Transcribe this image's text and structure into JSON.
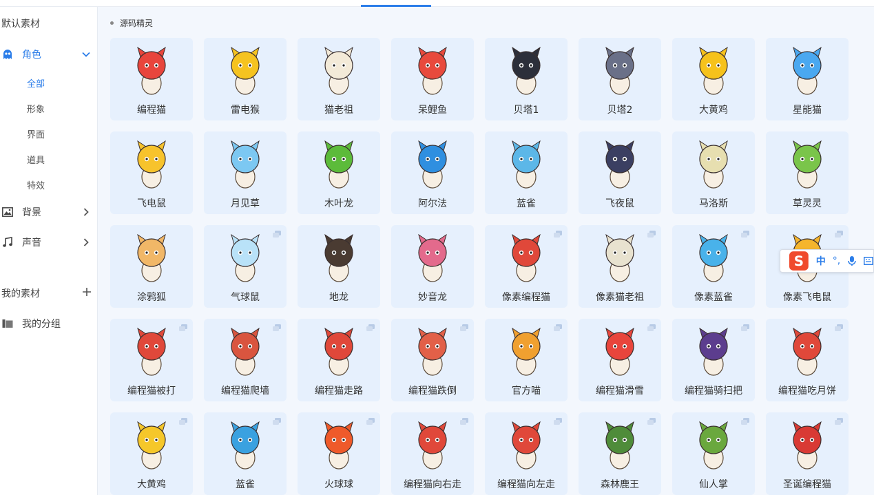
{
  "colors": {
    "accent": "#2b7de9",
    "card_bg": "#e6f0fd",
    "main_bg": "#f3f7fd"
  },
  "sidebar": {
    "default_assets_title": "默认素材",
    "categories": [
      {
        "label": "角色",
        "icon": "ghost-icon",
        "expanded": true
      },
      {
        "label": "背景",
        "icon": "image-icon",
        "expanded": false
      },
      {
        "label": "声音",
        "icon": "music-icon",
        "expanded": false
      }
    ],
    "subcategories": [
      "全部",
      "形象",
      "界面",
      "道具",
      "特效"
    ],
    "my_assets_title": "我的素材",
    "my_groups_label": "我的分组"
  },
  "main": {
    "group_title": "源码精灵",
    "items": [
      {
        "name": "编程猫",
        "icon": "coding-cat-icon",
        "color": "#e8453c",
        "multi": false
      },
      {
        "name": "雷电猴",
        "icon": "thunder-monkey-icon",
        "color": "#f5c320",
        "multi": false
      },
      {
        "name": "猫老祖",
        "icon": "cat-elder-icon",
        "color": "#f3ead8",
        "multi": false
      },
      {
        "name": "呆鲤鱼",
        "icon": "carp-icon",
        "color": "#e84a3d",
        "multi": false
      },
      {
        "name": "贝塔1",
        "icon": "beta-robot-icon",
        "color": "#2c2f3a",
        "multi": false
      },
      {
        "name": "贝塔2",
        "icon": "beta-robot-icon",
        "color": "#6a7088",
        "multi": false
      },
      {
        "name": "大黄鸡",
        "icon": "yellow-chicken-icon",
        "color": "#f6c21c",
        "multi": false
      },
      {
        "name": "星能猫",
        "icon": "star-cat-icon",
        "color": "#4aa8f0",
        "multi": false
      },
      {
        "name": "飞电鼠",
        "icon": "flying-mouse-icon",
        "color": "#f7c32c",
        "multi": false
      },
      {
        "name": "月见草",
        "icon": "moon-grass-icon",
        "color": "#7cc8f2",
        "multi": false
      },
      {
        "name": "木叶龙",
        "icon": "leaf-dragon-icon",
        "color": "#5cbb3a",
        "multi": false
      },
      {
        "name": "阿尔法",
        "icon": "alpha-icon",
        "color": "#2f8fe0",
        "multi": false
      },
      {
        "name": "蓝雀",
        "icon": "blue-bird-icon",
        "color": "#5cb7e8",
        "multi": false
      },
      {
        "name": "飞夜鼠",
        "icon": "night-mouse-icon",
        "color": "#3b3f62",
        "multi": false
      },
      {
        "name": "马洛斯",
        "icon": "maros-icon",
        "color": "#e7dfb0",
        "multi": false
      },
      {
        "name": "草灵灵",
        "icon": "grass-spirit-icon",
        "color": "#7ac54a",
        "multi": false
      },
      {
        "name": "涂鸦狐",
        "icon": "graffiti-fox-icon",
        "color": "#f1b767",
        "multi": false
      },
      {
        "name": "气球鼠",
        "icon": "balloon-mouse-icon",
        "color": "#b9e2f8",
        "multi": true
      },
      {
        "name": "地龙",
        "icon": "earth-dragon-icon",
        "color": "#4a3b32",
        "multi": false
      },
      {
        "name": "妙音龙",
        "icon": "melody-dragon-icon",
        "color": "#e36a8c",
        "multi": false
      },
      {
        "name": "像素编程猫",
        "icon": "pixel-coding-cat-icon",
        "color": "#e0483a",
        "multi": true
      },
      {
        "name": "像素猫老祖",
        "icon": "pixel-cat-elder-icon",
        "color": "#e8e2cf",
        "multi": true
      },
      {
        "name": "像素蓝雀",
        "icon": "pixel-blue-bird-icon",
        "color": "#49b2ea",
        "multi": true
      },
      {
        "name": "像素飞电鼠",
        "icon": "pixel-flying-mouse-icon",
        "color": "#f5b52d",
        "multi": true
      },
      {
        "name": "编程猫被打",
        "icon": "coding-cat-hit-icon",
        "color": "#e0483a",
        "multi": true
      },
      {
        "name": "编程猫爬墙",
        "icon": "coding-cat-climb-icon",
        "color": "#d9553f",
        "multi": true
      },
      {
        "name": "编程猫走路",
        "icon": "coding-cat-walk-icon",
        "color": "#e0483a",
        "multi": true
      },
      {
        "name": "编程猫跌倒",
        "icon": "coding-cat-fall-icon",
        "color": "#e26048",
        "multi": true
      },
      {
        "name": "官方喵",
        "icon": "official-cat-icon",
        "color": "#f0a030",
        "multi": true
      },
      {
        "name": "编程猫滑雪",
        "icon": "coding-cat-ski-icon",
        "color": "#e8453c",
        "multi": true
      },
      {
        "name": "编程猫骑扫把",
        "icon": "coding-cat-broom-icon",
        "color": "#5c3d8e",
        "multi": true
      },
      {
        "name": "编程猫吃月饼",
        "icon": "coding-cat-mooncake-icon",
        "color": "#e0483a",
        "multi": true
      },
      {
        "name": "大黄鸡",
        "icon": "yellow-chicken-ship-icon",
        "color": "#f5c72a",
        "multi": true
      },
      {
        "name": "蓝雀",
        "icon": "blue-bird-icon",
        "color": "#3aa1e0",
        "multi": true
      },
      {
        "name": "火球球",
        "icon": "fireball-icon",
        "color": "#ef5a2a",
        "multi": true
      },
      {
        "name": "编程猫向右走",
        "icon": "coding-cat-walk-right-icon",
        "color": "#e0483a",
        "multi": true
      },
      {
        "name": "编程猫向左走",
        "icon": "coding-cat-walk-left-icon",
        "color": "#e0483a",
        "multi": true
      },
      {
        "name": "森林鹿王",
        "icon": "forest-deer-king-icon",
        "color": "#4f8c3a",
        "multi": true
      },
      {
        "name": "仙人掌",
        "icon": "cactus-icon",
        "color": "#6aa83e",
        "multi": true
      },
      {
        "name": "圣诞编程猫",
        "icon": "christmas-coding-cat-icon",
        "color": "#d93a34",
        "multi": true
      }
    ]
  },
  "ime": {
    "logo": "sogou-s-icon",
    "mode": "中",
    "punct": "°,"
  }
}
